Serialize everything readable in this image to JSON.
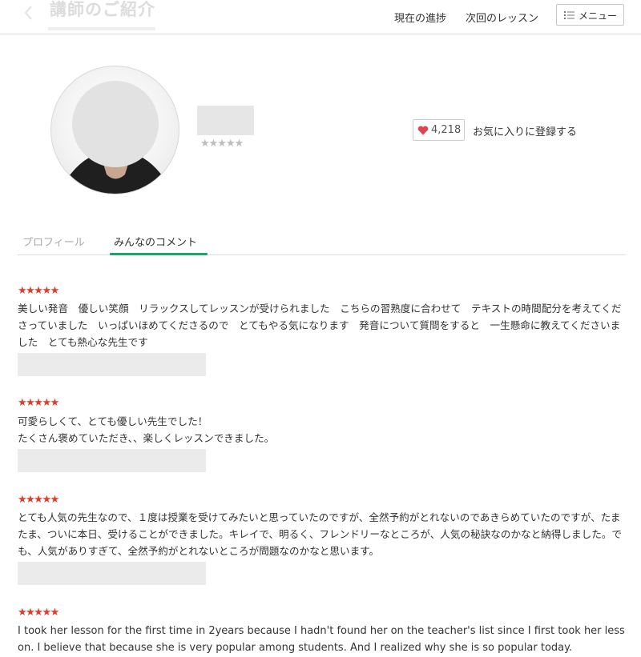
{
  "header": {
    "title": "講師のご紹介",
    "nav": {
      "progress": "現在の進捗",
      "next_lesson": "次回のレッスン"
    },
    "menu_label": "メニュー"
  },
  "profile": {
    "rating_stars": "★★★★★",
    "favorites_count": "4,218",
    "favorite_label": "お気に入りに登録する"
  },
  "tabs": {
    "profile": "プロフィール",
    "comments": "みんなのコメント",
    "active": "comments"
  },
  "comments": [
    {
      "stars": "★★★★★",
      "rating": 5,
      "text": "美しい発音　優しい笑顔　リラックスしてレッスンが受けられました　こちらの習熟度に合わせて　テキストの時間配分を考えてくださっていました　いっぱいほめてくださるので　とてもやる気になります　発音について質問をすると　一生懸命に教えてくださいました　とても熱心な先生です"
    },
    {
      "stars": "★★★★★",
      "rating": 5,
      "text": "可愛らしくて、とても優しい先生でした！\nたくさん褒めていただき、、楽しくレッスンできました。"
    },
    {
      "stars": "★★★★★",
      "rating": 5,
      "text": "とても人気の先生なので、１度は授業を受けてみたいと思っていたのですが、全然予約がとれないのであきらめていたのですが、たまたま、ついに本日、受けることができました。キレイで、明るく、フレンドリーなところが、人気の秘訣なのかなと納得しました。でも、人気がありすぎて、全然予約がとれないところが問題なのかなと思います。"
    },
    {
      "stars": "★★★★★",
      "rating": 5,
      "text": "I took her lesson for the first time in 2years because I hadn't found her on the teacher's list since I first took her lesson. I believe that because she is very popular among students. And I realized why she is so popular today."
    }
  ],
  "colors": {
    "accent_green": "#19a56b",
    "star_red": "#e03c28",
    "heart_red": "#e0454b"
  }
}
